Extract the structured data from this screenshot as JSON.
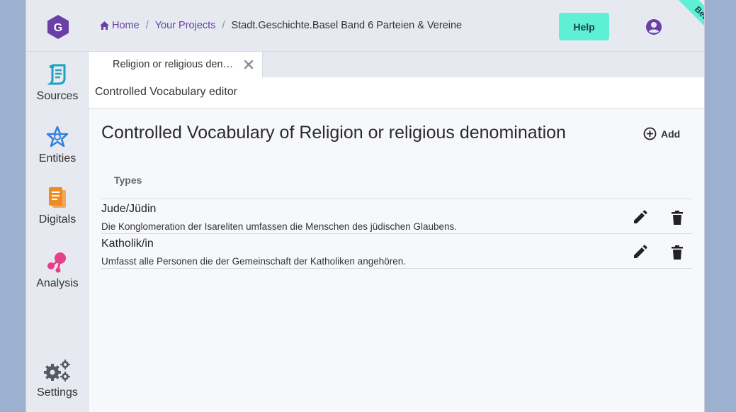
{
  "header": {
    "breadcrumb": {
      "home": "Home",
      "projects": "Your Projects",
      "current": "Stadt.Geschichte.Basel Band 6 Parteien & Vereine"
    },
    "help_label": "Help",
    "beta_label": "Beta"
  },
  "sidebar": {
    "items": [
      {
        "label": "Sources",
        "icon": "scroll-icon"
      },
      {
        "label": "Entities",
        "icon": "star-icon"
      },
      {
        "label": "Digitals",
        "icon": "document-icon"
      },
      {
        "label": "Analysis",
        "icon": "network-icon"
      },
      {
        "label": "Settings",
        "icon": "gears-icon"
      }
    ]
  },
  "tabs": [
    {
      "label": "Religion or religious den…"
    }
  ],
  "subheader": "Controlled Vocabulary editor",
  "main": {
    "title": "Controlled Vocabulary of Religion or religious denomination",
    "add_label": "Add",
    "column_header": "Types",
    "rows": [
      {
        "name": "Jude/Jüdin",
        "description": "Die Konglomeration der Isareliten umfassen die Menschen des jüdischen Glaubens."
      },
      {
        "name": "Katholik/in",
        "description": "Umfasst alle Personen die der Gemeinschaft der Katholiken angehören."
      }
    ]
  },
  "colors": {
    "accent": "#6a3fa8",
    "help": "#5ef0d4",
    "sources": "#1aa3c2",
    "entities": "#2f7fe0",
    "digitals": "#f08a24",
    "analysis": "#e83e8c",
    "settings": "#555a63"
  }
}
